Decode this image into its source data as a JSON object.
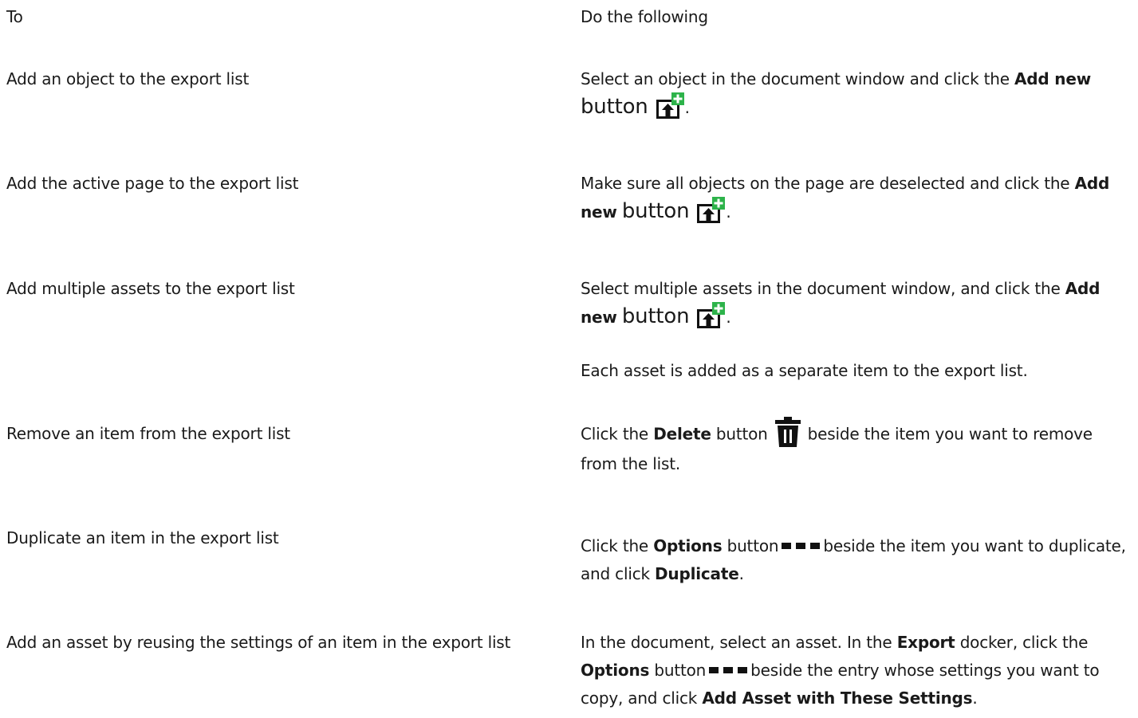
{
  "table": {
    "header": {
      "to": "To",
      "do": "Do the following"
    },
    "rows": [
      {
        "to": "Add an object to the export list",
        "do": {
          "t1": "Select an object in the document window and click the ",
          "b1": "Add new",
          "t2": "button",
          "t3": "."
        }
      },
      {
        "to": "Add the active page to the export list",
        "do": {
          "t1": "Make sure all objects on the page are deselected and click the ",
          "b1": "Add new",
          "t2": "button",
          "t3": "."
        }
      },
      {
        "to": "Add multiple assets to the export list",
        "do": {
          "t1": "Select multiple assets in the document window, and click the ",
          "b1": "Add new",
          "t2": "button",
          "t3": ".",
          "note": "Each asset is added as a separate item to the export list."
        }
      },
      {
        "to": "Remove an item from the export list",
        "do": {
          "t1": "Click the ",
          "b1": "Delete",
          "t2": " button",
          "t3": "beside the item you want to remove from the list."
        }
      },
      {
        "to": "Duplicate an item in the export list",
        "do": {
          "t1": "Click the ",
          "b1": "Options",
          "t2": " button",
          "t3": "beside the item you want to duplicate, and click ",
          "b2": "Duplicate",
          "t4": "."
        }
      },
      {
        "to": "Add an asset by reusing the settings of an item in the export list",
        "do": {
          "t1": "In the document, select an asset. In the ",
          "b1": "Export",
          "t2": " docker, click the ",
          "b2": "Options",
          "t3": " button",
          "t4": "beside the entry whose settings you want to copy, and click ",
          "b3": "Add Asset with These Settings",
          "t5": "."
        }
      }
    ]
  },
  "icons": {
    "add_new": "export-add-new-icon",
    "delete": "trash-icon",
    "options": "more-options-icon"
  },
  "colors": {
    "text": "#1a1a1a",
    "icon_green": "#2db34a",
    "icon_dark": "#111111"
  }
}
